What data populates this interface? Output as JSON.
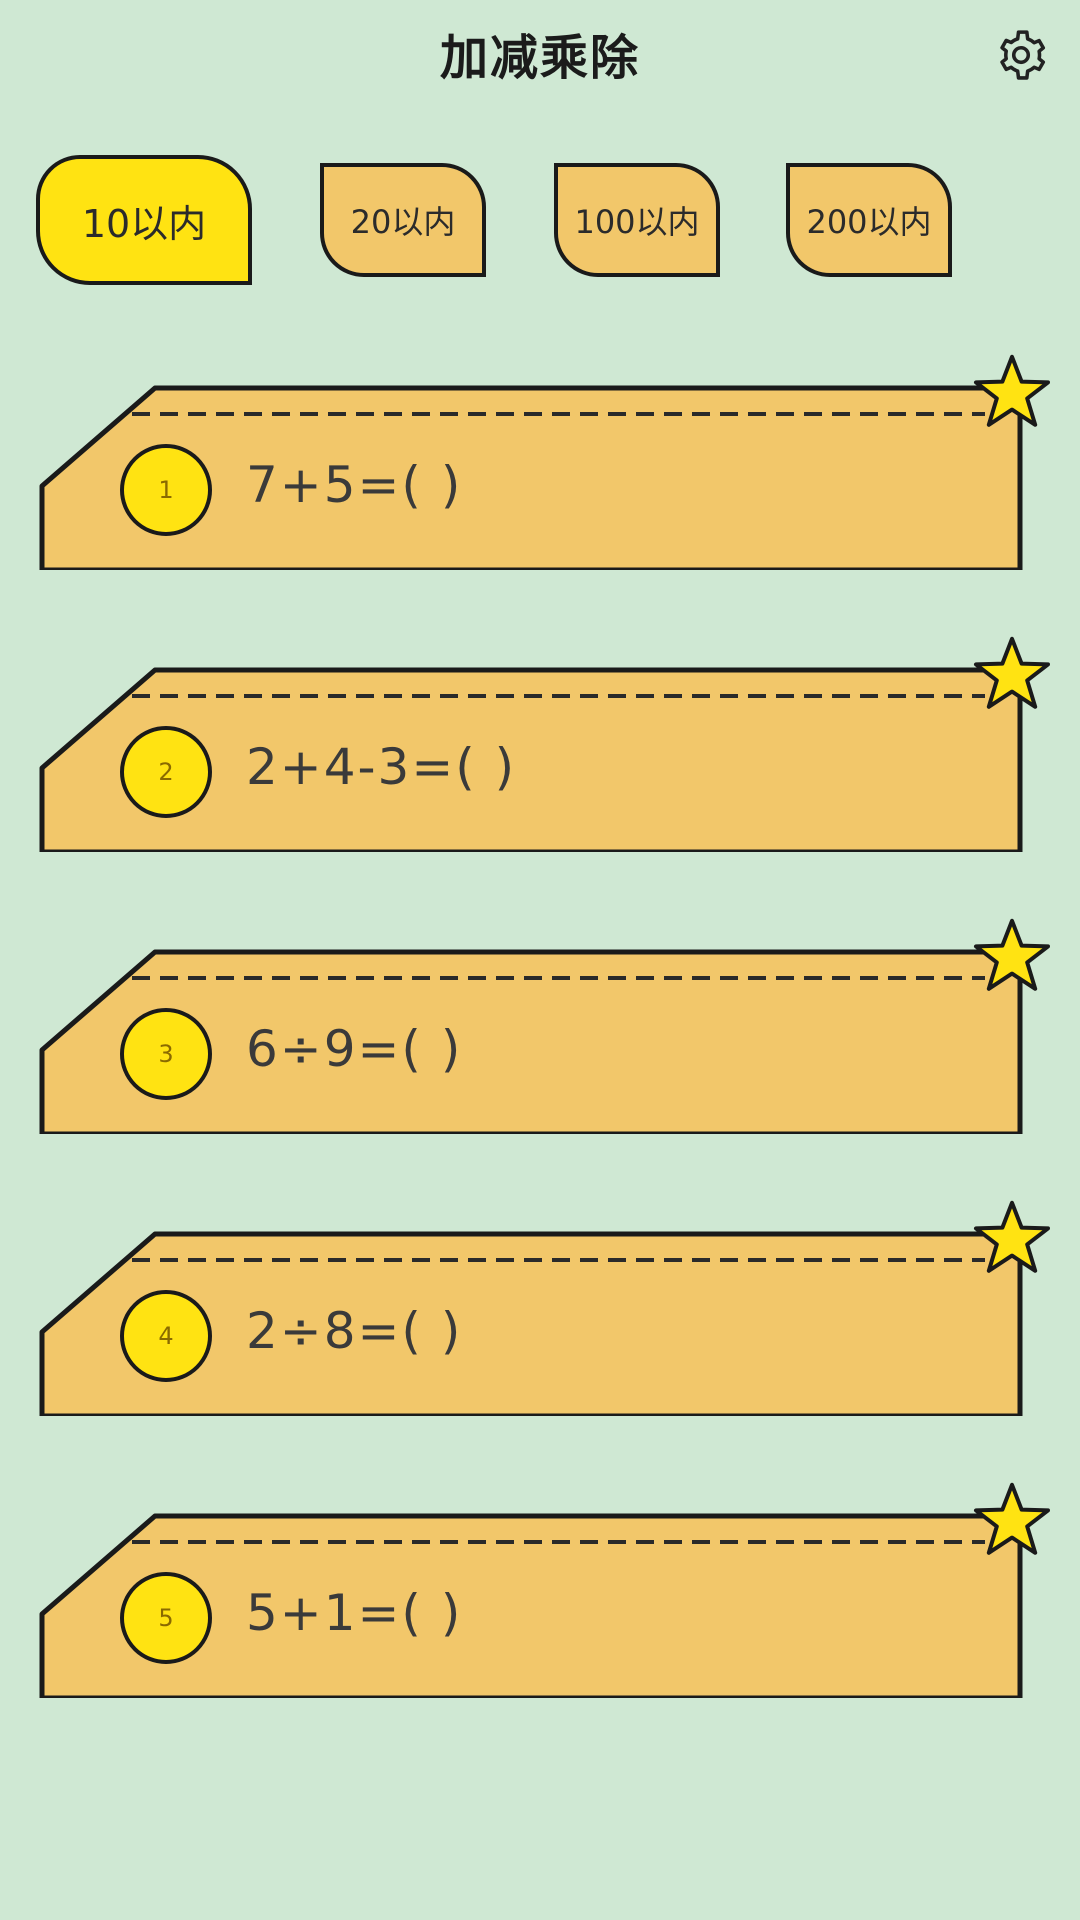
{
  "header": {
    "title": "加减乘除",
    "settings_icon": "gear-icon"
  },
  "tabs": [
    {
      "label": "10以内",
      "active": true
    },
    {
      "label": "20以内",
      "active": false
    },
    {
      "label": "100以内",
      "active": false
    },
    {
      "label": "200以内",
      "active": false
    }
  ],
  "questions": [
    {
      "number": "1",
      "expr": "7+5=( )"
    },
    {
      "number": "2",
      "expr": "2+4-3=( )"
    },
    {
      "number": "3",
      "expr": "6÷9=( )"
    },
    {
      "number": "4",
      "expr": "2÷8=( )"
    },
    {
      "number": "5",
      "expr": "5+1=( )"
    }
  ],
  "colors": {
    "background": "#cfe8d3",
    "card": "#f2c76a",
    "active_tab": "#ffe312",
    "star": "#ffe312",
    "outline": "#1a1a1a"
  }
}
